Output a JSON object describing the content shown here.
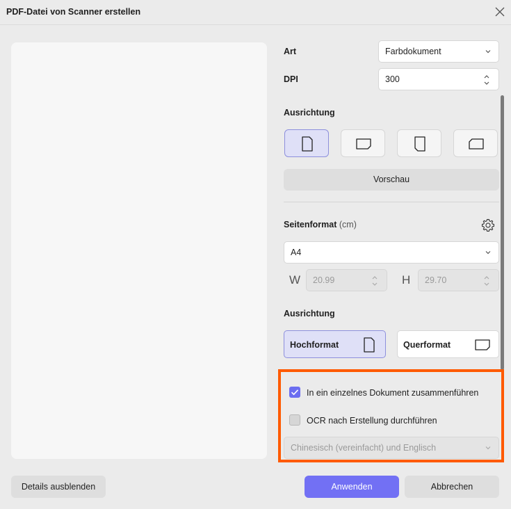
{
  "window": {
    "title": "PDF-Datei von Scanner erstellen"
  },
  "settings": {
    "type_label": "Art",
    "type_value": "Farbdokument",
    "dpi_label": "DPI",
    "dpi_value": "300",
    "orientation_label": "Ausrichtung",
    "orientation_options": [
      "portrait-icon",
      "landscape-icon",
      "rotate-left-icon",
      "rotate-right-icon"
    ],
    "preview_button": "Vorschau"
  },
  "page_format": {
    "label": "Seitenformat",
    "unit": "(cm)",
    "size_value": "A4",
    "width_label": "W",
    "width_value": "20.99",
    "height_label": "H",
    "height_value": "29.70",
    "orientation_label": "Ausrichtung",
    "portrait_label": "Hochformat",
    "landscape_label": "Querformat"
  },
  "options": {
    "merge_label": "In ein einzelnes Dokument zusammenführen",
    "merge_checked": true,
    "ocr_label": "OCR nach Erstellung durchführen",
    "ocr_checked": false,
    "ocr_language": "Chinesisch (vereinfacht) und Englisch"
  },
  "footer": {
    "hide_details": "Details ausblenden",
    "apply": "Anwenden",
    "cancel": "Abbrechen"
  },
  "colors": {
    "accent": "#7270f4",
    "highlight": "#ff5a00",
    "active_bg": "#dfe0f7"
  }
}
